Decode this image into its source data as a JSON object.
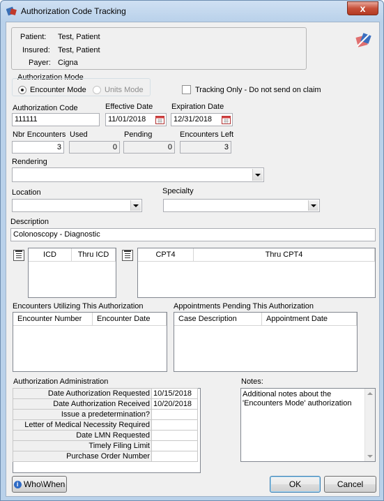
{
  "window": {
    "title": "Authorization Code Tracking",
    "close_glyph": "x"
  },
  "patient_info": {
    "patient_label": "Patient:",
    "patient_value": "Test, Patient",
    "insured_label": "Insured:",
    "insured_value": "Test, Patient",
    "payer_label": "Payer:",
    "payer_value": "Cigna"
  },
  "auth_mode": {
    "group_label": "Authorization Mode",
    "encounter_label": "Encounter Mode",
    "units_label": "Units Mode",
    "selected": "Encounter Mode"
  },
  "tracking_only": {
    "label": "Tracking Only - Do not send on claim",
    "checked": false
  },
  "auth_code": {
    "label": "Authorization Code",
    "value": "111111"
  },
  "effective_date": {
    "label": "Effective Date",
    "value": "11/01/2018"
  },
  "expiration_date": {
    "label": "Expiration Date",
    "value": "12/31/2018"
  },
  "counts": {
    "nbr_label": "Nbr Encounters",
    "nbr_value": "3",
    "used_label": "Used",
    "used_value": "0",
    "pending_label": "Pending",
    "pending_value": "0",
    "left_label": "Encounters Left",
    "left_value": "3"
  },
  "rendering": {
    "label": "Rendering",
    "value": ""
  },
  "location": {
    "label": "Location",
    "value": ""
  },
  "specialty": {
    "label": "Specialty",
    "value": ""
  },
  "description": {
    "label": "Description",
    "value": "Colonoscopy - Diagnostic"
  },
  "icd_list": {
    "col1": "ICD",
    "col2": "Thru ICD"
  },
  "cpt_list": {
    "col1": "CPT4",
    "col2": "Thru CPT4"
  },
  "encounters_section": {
    "label": "Encounters Utilizing This Authorization",
    "col1": "Encounter Number",
    "col2": "Encounter Date"
  },
  "appointments_section": {
    "label": "Appointments Pending This Authorization",
    "col1": "Case Description",
    "col2": "Appointment Date"
  },
  "administration": {
    "label": "Authorization Administration",
    "rows": [
      {
        "key": "Date Authorization Requested",
        "value": "10/15/2018"
      },
      {
        "key": "Date Authorization Received",
        "value": "10/20/2018"
      },
      {
        "key": "Issue a predetermination?",
        "value": ""
      },
      {
        "key": "Letter of Medical Necessity Required",
        "value": ""
      },
      {
        "key": "Date LMN Requested",
        "value": ""
      },
      {
        "key": "Timely Filing Limit",
        "value": ""
      },
      {
        "key": "Purchase Order Number",
        "value": ""
      }
    ]
  },
  "notes": {
    "label": "Notes:",
    "value": "Additional notes about the 'Encounters Mode' authorization"
  },
  "buttons": {
    "who_when": "Who\\When",
    "ok": "OK",
    "cancel": "Cancel"
  },
  "icons": [
    "app-icon",
    "calendar-icon",
    "list-edit-icon",
    "dropdown-arrow-icon",
    "logo-icon"
  ]
}
